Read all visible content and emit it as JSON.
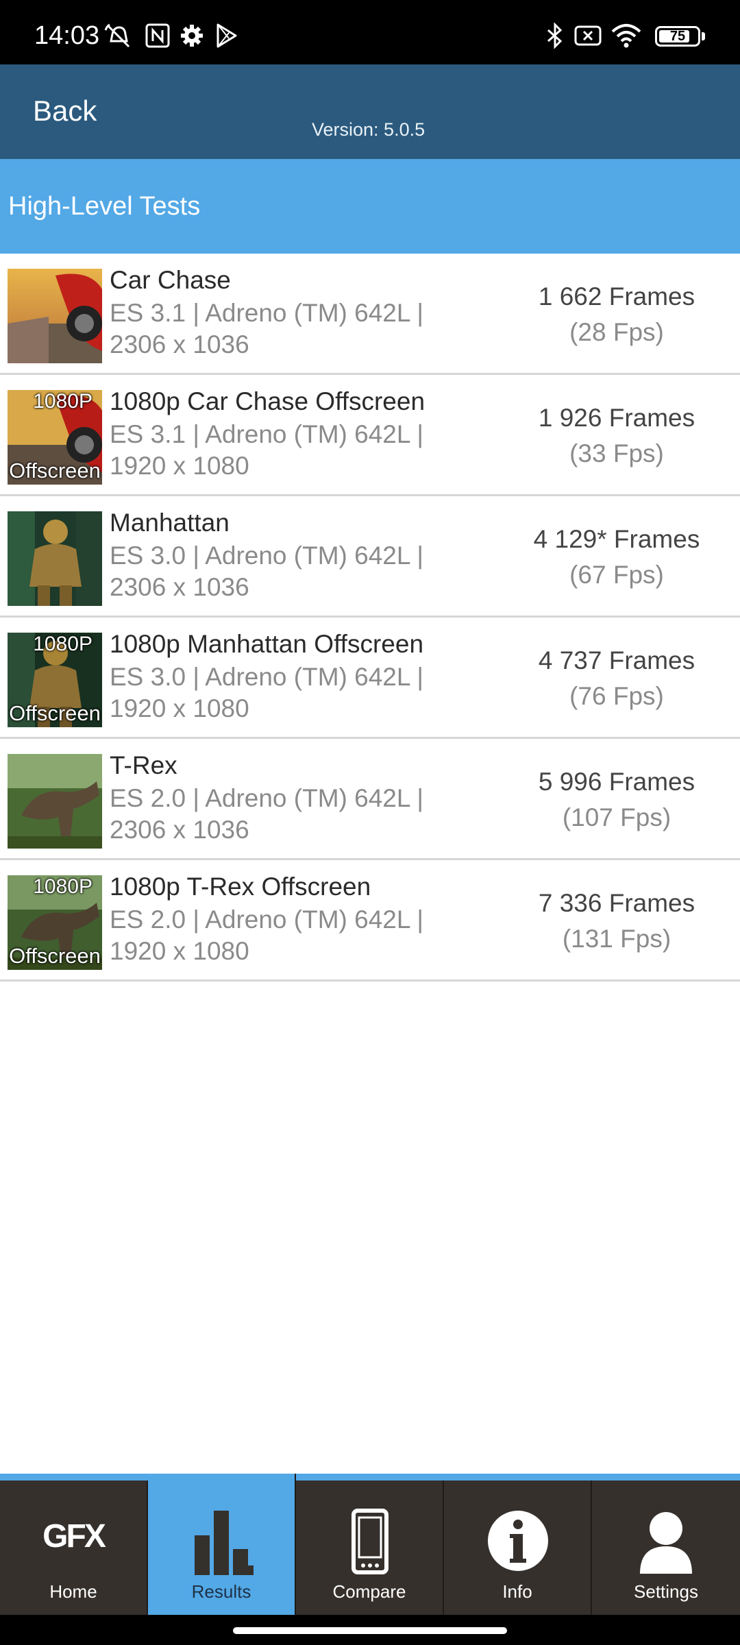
{
  "status_bar": {
    "time": "14:03",
    "battery": "75",
    "icons": [
      "muted-alarm-icon",
      "nfc-icon",
      "settings-gear-icon",
      "play-store-icon",
      "bluetooth-icon",
      "sim-off-icon",
      "wifi-icon",
      "battery-icon"
    ]
  },
  "topbar": {
    "back_label": "Back",
    "version": "Version: 5.0.5"
  },
  "section": {
    "title": "High-Level Tests"
  },
  "tests": [
    {
      "name": "Car Chase",
      "desc": "ES 3.1 | Adreno (TM) 642L | 2306 x 1036",
      "frames": "1 662 Frames",
      "fps": "(28 Fps)",
      "thumb_top": "",
      "thumb_bottom": ""
    },
    {
      "name": "1080p Car Chase Offscreen",
      "desc": "ES 3.1 | Adreno (TM) 642L | 1920 x 1080",
      "frames": "1 926 Frames",
      "fps": "(33 Fps)",
      "thumb_top": "1080P",
      "thumb_bottom": "Offscreen"
    },
    {
      "name": "Manhattan",
      "desc": "ES 3.0 | Adreno (TM) 642L | 2306 x 1036",
      "frames": "4 129* Frames",
      "fps": "(67 Fps)",
      "thumb_top": "",
      "thumb_bottom": ""
    },
    {
      "name": "1080p Manhattan Offscreen",
      "desc": "ES 3.0 | Adreno (TM) 642L | 1920 x 1080",
      "frames": "4 737 Frames",
      "fps": "(76 Fps)",
      "thumb_top": "1080P",
      "thumb_bottom": "Offscreen"
    },
    {
      "name": "T-Rex",
      "desc": "ES 2.0 | Adreno (TM) 642L | 2306 x 1036",
      "frames": "5 996 Frames",
      "fps": "(107 Fps)",
      "thumb_top": "",
      "thumb_bottom": ""
    },
    {
      "name": "1080p T-Rex Offscreen",
      "desc": "ES 2.0 | Adreno (TM) 642L | 1920 x 1080",
      "frames": "7 336 Frames",
      "fps": "(131 Fps)",
      "thumb_top": "1080P",
      "thumb_bottom": "Offscreen"
    }
  ],
  "nav": {
    "gfx_logo": "GFX",
    "items": [
      {
        "label": "Home",
        "icon": "gfx-logo-icon"
      },
      {
        "label": "Results",
        "icon": "bar-chart-icon",
        "active": true
      },
      {
        "label": "Compare",
        "icon": "phone-icon"
      },
      {
        "label": "Info",
        "icon": "info-icon"
      },
      {
        "label": "Settings",
        "icon": "user-icon"
      }
    ]
  },
  "colors": {
    "topbar": "#2b5a7e",
    "accent": "#53a8e6",
    "nav_bg": "#35302c"
  }
}
